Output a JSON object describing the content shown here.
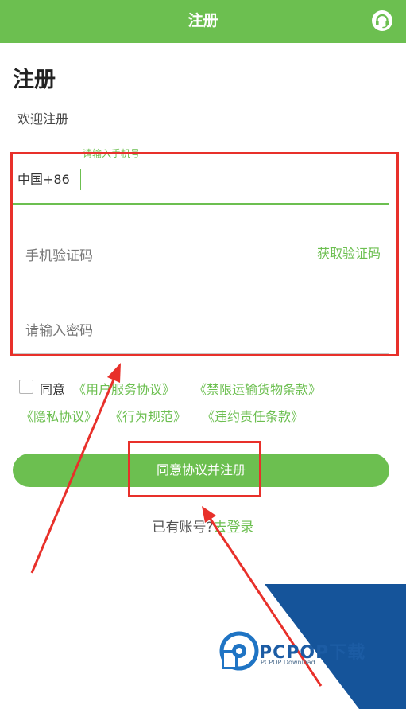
{
  "header": {
    "title": "注册",
    "support_icon": "headset-icon",
    "bar_color": "#6cbf50"
  },
  "page": {
    "title": "注册",
    "subtitle": "欢迎注册"
  },
  "form": {
    "phone": {
      "floating_label": "请输入手机号",
      "country_code": "中国+86",
      "value": ""
    },
    "code": {
      "placeholder": "手机验证码",
      "get_code_label": "获取验证码"
    },
    "password": {
      "placeholder": "请输入密码"
    },
    "accent_color": "#6cbf50"
  },
  "agreement": {
    "agree_label": "同意",
    "checked": false,
    "links": [
      "《用户服务协议》",
      "《禁限运输货物条款》",
      "《隐私协议》",
      "《行为规范》",
      "《违约责任条款》"
    ]
  },
  "actions": {
    "register_label": "同意协议并注册",
    "login_prompt": "已有账号?",
    "login_link": "去登录"
  },
  "annotation_color": "#e8302a",
  "watermark": {
    "brand": "PCPOP下载",
    "sub": "PCPOP Download"
  }
}
